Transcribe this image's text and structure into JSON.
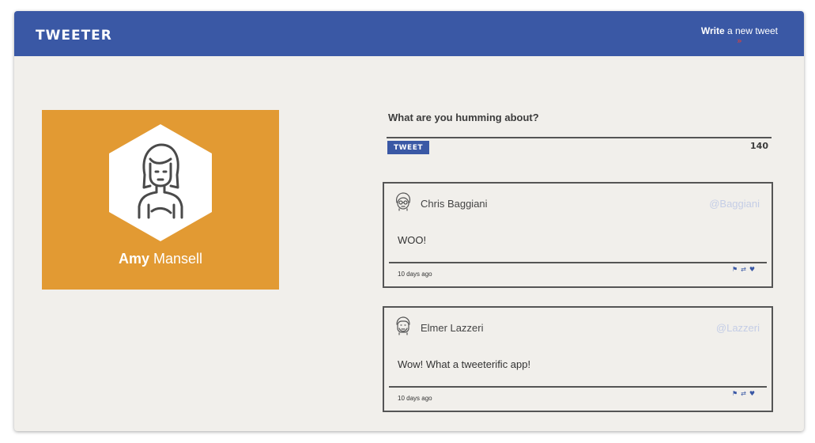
{
  "navbar": {
    "logo": "TWEETER",
    "compose_bold": "Write",
    "compose_rest": " a new tweet",
    "chevron": "»"
  },
  "profile": {
    "first_name": "Amy",
    "last_name": " Mansell",
    "card_color": "#e29a33"
  },
  "composer": {
    "prompt": "What are you humming about?",
    "button_label": "TWEET",
    "counter": "140"
  },
  "tweets": [
    {
      "author": "Chris Baggiani",
      "handle": "@Baggiani",
      "content": "WOO!",
      "date": "10 days ago",
      "avatar_icon": "user-avatar-glasses-icon"
    },
    {
      "author": "Elmer Lazzeri",
      "handle": "@Lazzeri",
      "content": "Wow! What a tweeterific app!",
      "date": "10 days ago",
      "avatar_icon": "user-avatar-beard-icon"
    }
  ],
  "icons": {
    "flag": "⚑",
    "retweet": "⇄",
    "heart": "♥"
  },
  "colors": {
    "brand": "#3a58a5",
    "background": "#f1efeb",
    "accent": "#e0413a",
    "handle": "#c4cde6"
  }
}
